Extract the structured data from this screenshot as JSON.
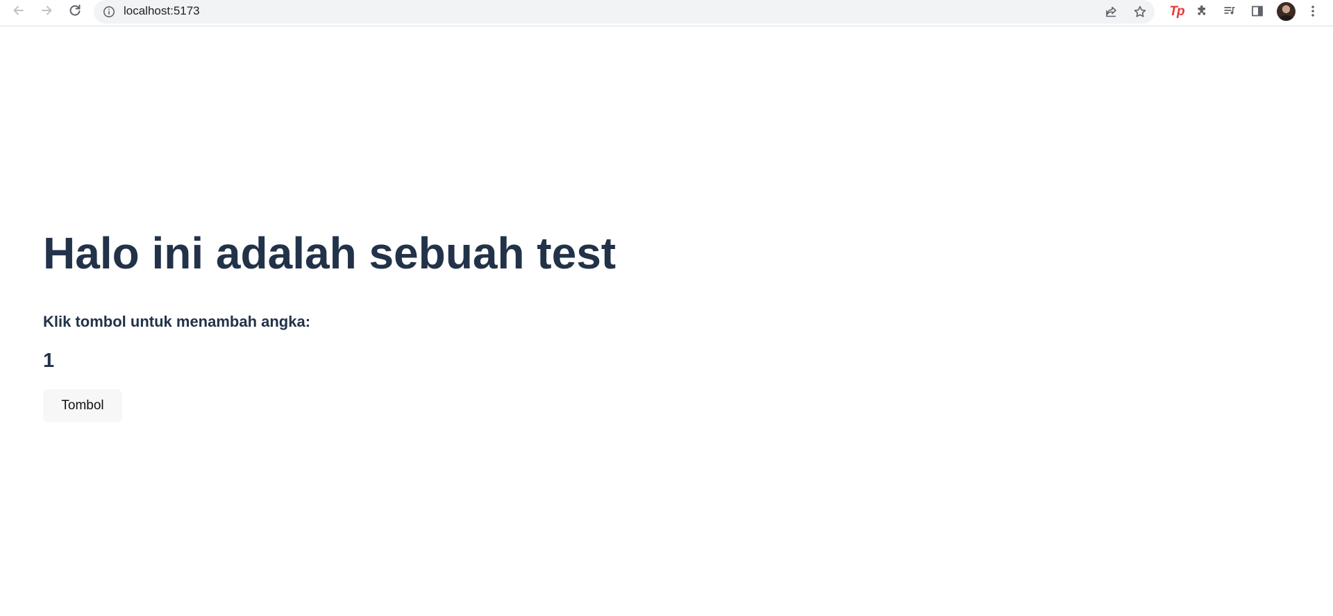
{
  "browser": {
    "url": "localhost:5173",
    "icons": {
      "back": "arrow-left-icon",
      "forward": "arrow-right-icon",
      "reload": "reload-icon",
      "site_info": "info-icon",
      "share": "share-icon",
      "bookmark": "star-icon",
      "extension_tp": "tp-extension-icon",
      "extensions": "puzzle-icon",
      "media": "media-queue-icon",
      "side_panel": "side-panel-icon",
      "profile": "avatar",
      "menu": "kebab-menu-icon"
    },
    "extension_tp_label": "Tp",
    "accent_color": "#e53935"
  },
  "page": {
    "title": "Halo ini adalah sebuah test",
    "instruction": "Klik tombol untuk menambah angka:",
    "count": "1",
    "button_label": "Tombol",
    "text_color": "#223249",
    "button_bg": "#f7f7f7"
  }
}
